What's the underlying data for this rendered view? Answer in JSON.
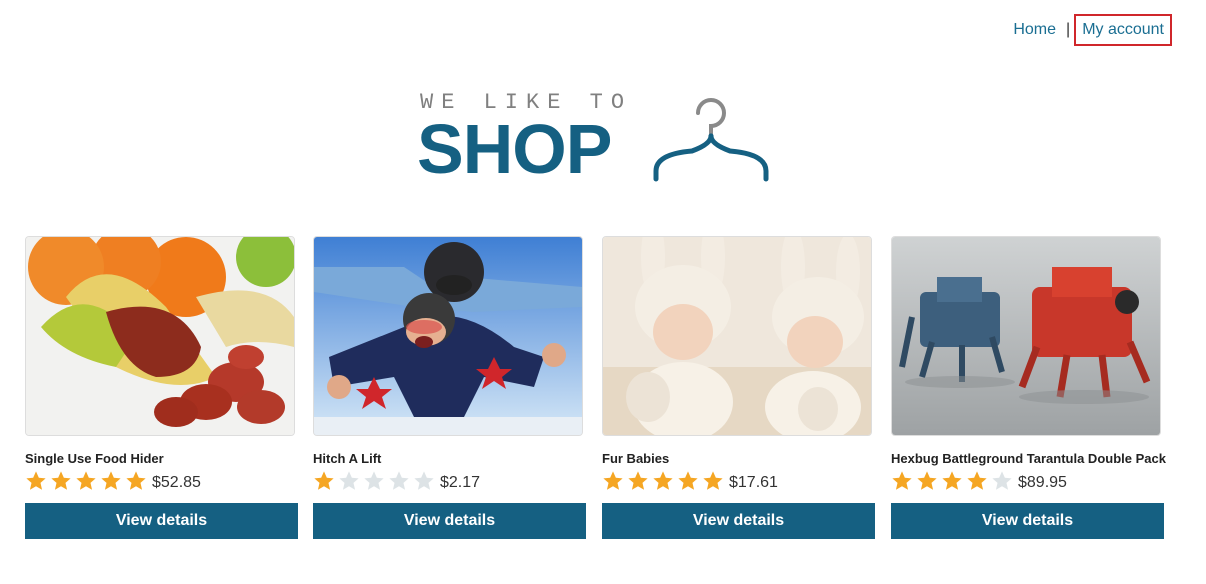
{
  "nav": {
    "home": "Home",
    "separator": "|",
    "account": "My account"
  },
  "logo": {
    "tagline": "WE LIKE TO",
    "word": "SHOP"
  },
  "products": [
    {
      "title": "Single Use Food Hider",
      "rating": 5,
      "price": "$52.85",
      "button": "View details"
    },
    {
      "title": "Hitch A Lift",
      "rating": 1,
      "price": "$2.17",
      "button": "View details"
    },
    {
      "title": "Fur Babies",
      "rating": 5,
      "price": "$17.61",
      "button": "View details"
    },
    {
      "title": "Hexbug Battleground Tarantula Double Pack",
      "rating": 4,
      "price": "$89.95",
      "button": "View details"
    }
  ],
  "colors": {
    "brand": "#156082",
    "star_on": "#f5a623",
    "star_off": "#dde3e6",
    "highlight": "#d0262b"
  }
}
